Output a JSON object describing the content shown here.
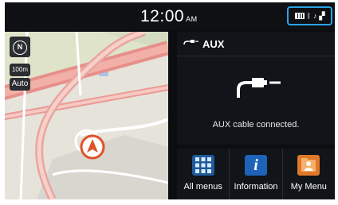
{
  "status_bar": {
    "time": "12:00",
    "ampm": "AM",
    "icons": [
      "battery-icon",
      "bluetooth-icon",
      "music-note-icon",
      "signal-icon"
    ]
  },
  "map": {
    "compass_label": "N",
    "scale_label": "100m",
    "zoom_mode_label": "Auto"
  },
  "aux": {
    "title": "AUX",
    "status_text": "AUX cable connected."
  },
  "menu": {
    "items": [
      {
        "label": "All menus",
        "icon": "grid-icon"
      },
      {
        "label": "Information",
        "icon": "info-icon"
      },
      {
        "label": "My Menu",
        "icon": "my-menu-icon"
      }
    ]
  },
  "colors": {
    "accent": "#2aa3e8",
    "position_marker": "#e0522a",
    "road": "#e78f8a"
  }
}
